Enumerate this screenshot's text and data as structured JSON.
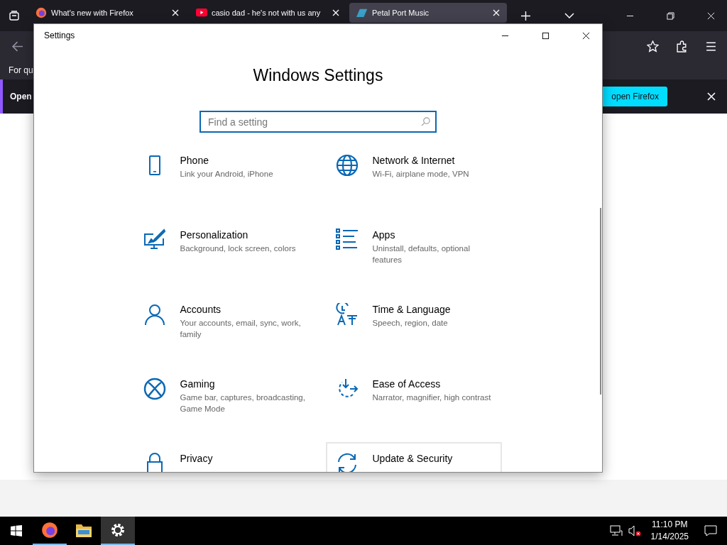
{
  "browser": {
    "tabs": [
      {
        "title": "What's new with Firefox",
        "kind": "firefox",
        "selected": false
      },
      {
        "title": "casio dad - he's not with us any",
        "kind": "video",
        "selected": false
      },
      {
        "title": "Petal Port Music",
        "kind": "site",
        "selected": true
      }
    ],
    "toolbar_text": "For qu",
    "notification": {
      "text": "Open",
      "button": "open Firefox"
    }
  },
  "settings_window": {
    "title": "Settings",
    "heading": "Windows Settings",
    "search": {
      "placeholder": "Find a setting"
    },
    "categories": [
      {
        "name": "Phone",
        "description": "Link your Android, iPhone",
        "kind": "phone",
        "hovered": false
      },
      {
        "name": "Network & Internet",
        "description": "Wi-Fi, airplane mode, VPN",
        "kind": "globe",
        "hovered": false
      },
      {
        "name": "Personalization",
        "description": "Background, lock screen, colors",
        "kind": "brush",
        "hovered": false
      },
      {
        "name": "Apps",
        "description": "Uninstall, defaults, optional features",
        "kind": "list",
        "hovered": false
      },
      {
        "name": "Accounts",
        "description": "Your accounts, email, sync, work, family",
        "kind": "person",
        "hovered": false
      },
      {
        "name": "Time & Language",
        "description": "Speech, region, date",
        "kind": "clock",
        "hovered": false
      },
      {
        "name": "Gaming",
        "description": "Game bar, captures, broadcasting, Game Mode",
        "kind": "xbox",
        "hovered": false
      },
      {
        "name": "Ease of Access",
        "description": "Narrator, magnifier, high contrast",
        "kind": "timer",
        "hovered": false
      },
      {
        "name": "Privacy",
        "kind": "lock",
        "hovered": false
      },
      {
        "name": "Update & Security",
        "kind": "sync",
        "hovered": true
      }
    ]
  },
  "taskbar": {
    "apps": [
      {
        "kind": "firefox",
        "running": true,
        "active": false
      },
      {
        "kind": "folder",
        "running": false,
        "active": false
      },
      {
        "kind": "gear",
        "running": true,
        "active": true
      }
    ],
    "time": "11:10 PM",
    "date": "1/14/2025"
  }
}
